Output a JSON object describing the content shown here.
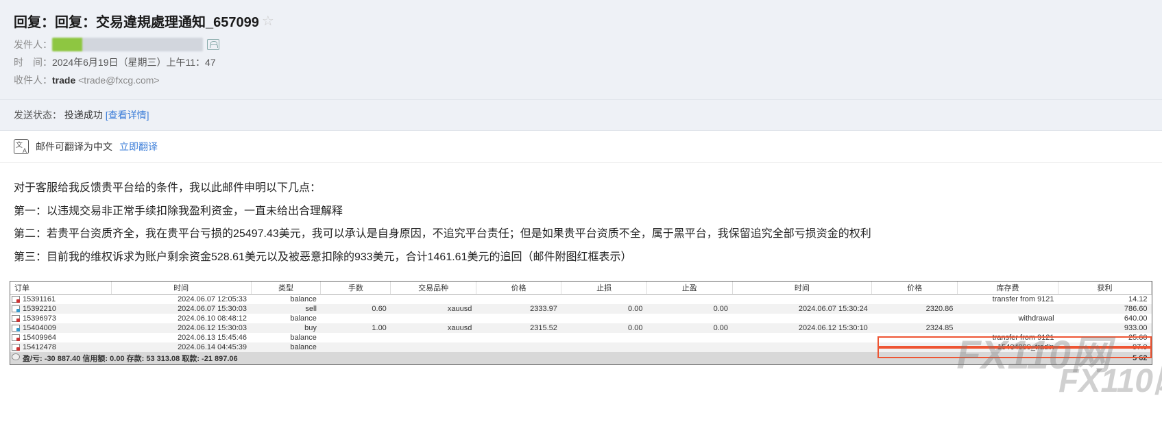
{
  "email": {
    "subject": "回复：回复：交易違規處理通知_657099",
    "sender_label": "发件人：",
    "time_label": "时　间：",
    "time_value": "2024年6月19日（星期三）上午11：47",
    "recipient_label": "收件人：",
    "recipient_name": "trade",
    "recipient_email": "<trade@fxcg.com>",
    "status_label": "发送状态：",
    "status_value": "投递成功",
    "status_link": "[查看详情]",
    "translate_text": "邮件可翻译为中文",
    "translate_link": "立即翻译"
  },
  "body": {
    "p1": "对于客服给我反馈贵平台给的条件，我以此邮件申明以下几点：",
    "p2": "第一：以违规交易非正常手续扣除我盈利资金，一直未给出合理解释",
    "p3": "第二：若贵平台资质齐全，我在贵平台亏损的25497.43美元，我可以承认是自身原因，不追究平台责任；但是如果贵平台资质不全，属于黑平台，我保留追究全部亏损资金的权利",
    "p4": "第三：目前我的维权诉求为账户剩余资金528.61美元以及被恶意扣除的933美元，合计1461.61美元的追回（邮件附图红框表示）"
  },
  "table": {
    "headers": [
      "订单",
      "时间",
      "类型",
      "手数",
      "交易品种",
      "价格",
      "止损",
      "止盈",
      "时间",
      "价格",
      "库存费",
      "获利"
    ],
    "rows": [
      {
        "icon": "r1",
        "order": "15391161",
        "time": "2024.06.07 12:05:33",
        "type": "balance",
        "lots": "",
        "symbol": "",
        "price": "",
        "sl": "",
        "tp": "",
        "time2": "",
        "price2": "",
        "fee": "transfer from 9121",
        "profit": "14.12"
      },
      {
        "icon": "r2",
        "order": "15392210",
        "time": "2024.06.07 15:30:03",
        "type": "sell",
        "lots": "0.60",
        "symbol": "xauusd",
        "price": "2333.97",
        "sl": "0.00",
        "tp": "0.00",
        "time2": "2024.06.07 15:30:24",
        "price2": "2320.86",
        "fee": "",
        "profit": "786.60"
      },
      {
        "icon": "r1",
        "order": "15396973",
        "time": "2024.06.10 08:48:12",
        "type": "balance",
        "lots": "",
        "symbol": "",
        "price": "",
        "sl": "",
        "tp": "",
        "time2": "",
        "price2": "",
        "fee": "withdrawal",
        "profit": "640.00"
      },
      {
        "icon": "r2",
        "order": "15404009",
        "time": "2024.06.12 15:30:03",
        "type": "buy",
        "lots": "1.00",
        "symbol": "xauusd",
        "price": "2315.52",
        "sl": "0.00",
        "tp": "0.00",
        "time2": "2024.06.12 15:30:10",
        "price2": "2324.85",
        "fee": "",
        "profit": "933.00"
      },
      {
        "icon": "r1",
        "order": "15409964",
        "time": "2024.06.13 15:45:46",
        "type": "balance",
        "lots": "",
        "symbol": "",
        "price": "",
        "sl": "",
        "tp": "",
        "time2": "",
        "price2": "",
        "fee": "transfer from 9121",
        "profit": "25.60"
      },
      {
        "icon": "r1",
        "order": "15412478",
        "time": "2024.06.14 04:45:39",
        "type": "balance",
        "lots": "",
        "symbol": "",
        "price": "",
        "sl": "",
        "tp": "",
        "time2": "",
        "price2": "",
        "fee": "15404009_tradin",
        "profit": "97.0"
      }
    ],
    "summary": "盈/亏: -30 887.40  信用额: 0.00  存款: 53 313.08  取款: -21 897.06",
    "summary_right": "5    62"
  },
  "watermark": "FX110网"
}
